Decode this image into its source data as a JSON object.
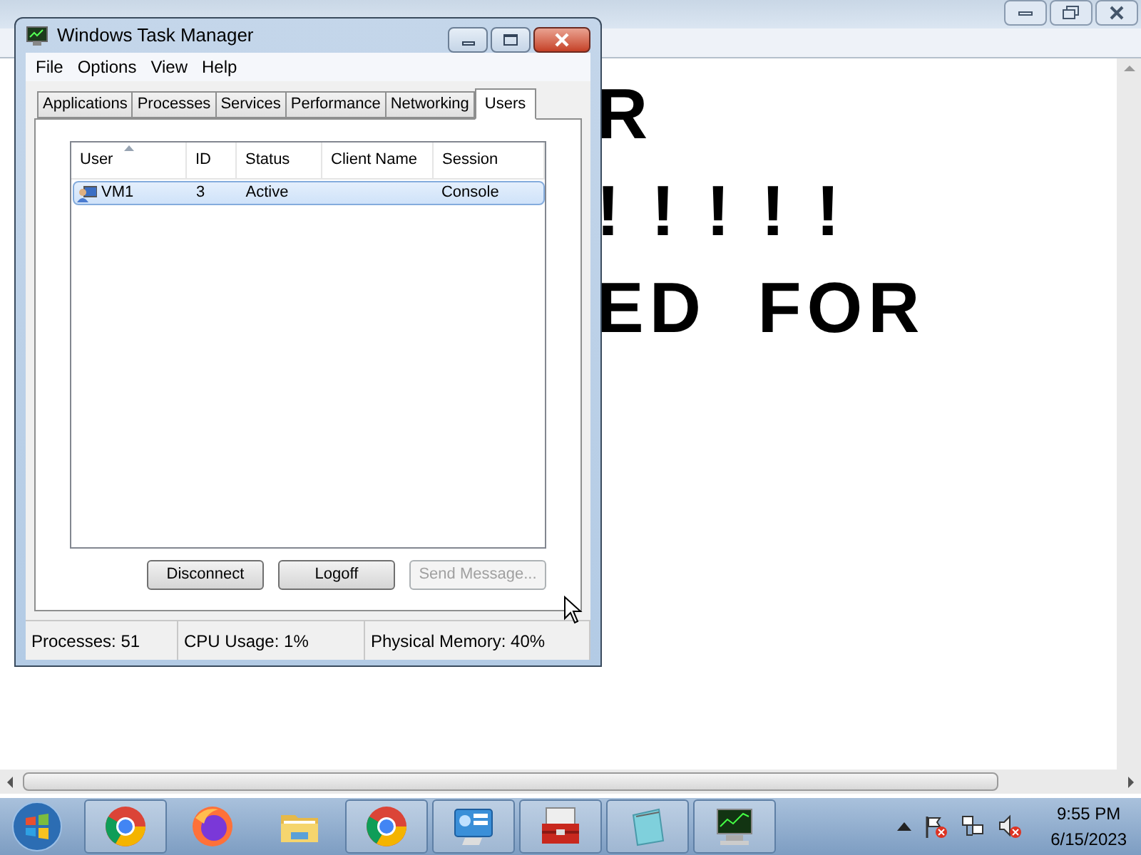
{
  "notepad": {
    "text_lines": [
      "R",
      "! ! ! ! !",
      "ED  FOR"
    ]
  },
  "task_manager": {
    "title": "Windows Task Manager",
    "menu": [
      "File",
      "Options",
      "View",
      "Help"
    ],
    "tabs": [
      {
        "label": "Applications",
        "selected": false
      },
      {
        "label": "Processes",
        "selected": false
      },
      {
        "label": "Services",
        "selected": false
      },
      {
        "label": "Performance",
        "selected": false
      },
      {
        "label": "Networking",
        "selected": false
      },
      {
        "label": "Users",
        "selected": true
      }
    ],
    "table": {
      "columns": [
        "User",
        "ID",
        "Status",
        "Client Name",
        "Session"
      ],
      "rows": [
        {
          "user": "VM1",
          "id": "3",
          "status": "Active",
          "session": "Console",
          "selected": true
        }
      ]
    },
    "buttons": [
      {
        "label": "Disconnect",
        "disabled": false
      },
      {
        "label": "Logoff",
        "disabled": false
      },
      {
        "label": "Send Message...",
        "disabled": true
      }
    ],
    "status_bar": [
      "Processes: 51",
      "CPU Usage: 1%",
      "Physical Memory: 40%"
    ]
  },
  "taskbar": {
    "items": [
      {
        "kind": "chrome",
        "running": true
      },
      {
        "kind": "firefox",
        "running": false
      },
      {
        "kind": "folder",
        "running": false
      },
      {
        "kind": "chrome",
        "running": true
      },
      {
        "kind": "control-panel",
        "running": true
      },
      {
        "kind": "toolbox",
        "running": true
      },
      {
        "kind": "notepad",
        "running": true
      },
      {
        "kind": "task-manager",
        "running": true
      }
    ],
    "clock": {
      "time": "9:55 PM",
      "date": "6/15/2023"
    }
  }
}
